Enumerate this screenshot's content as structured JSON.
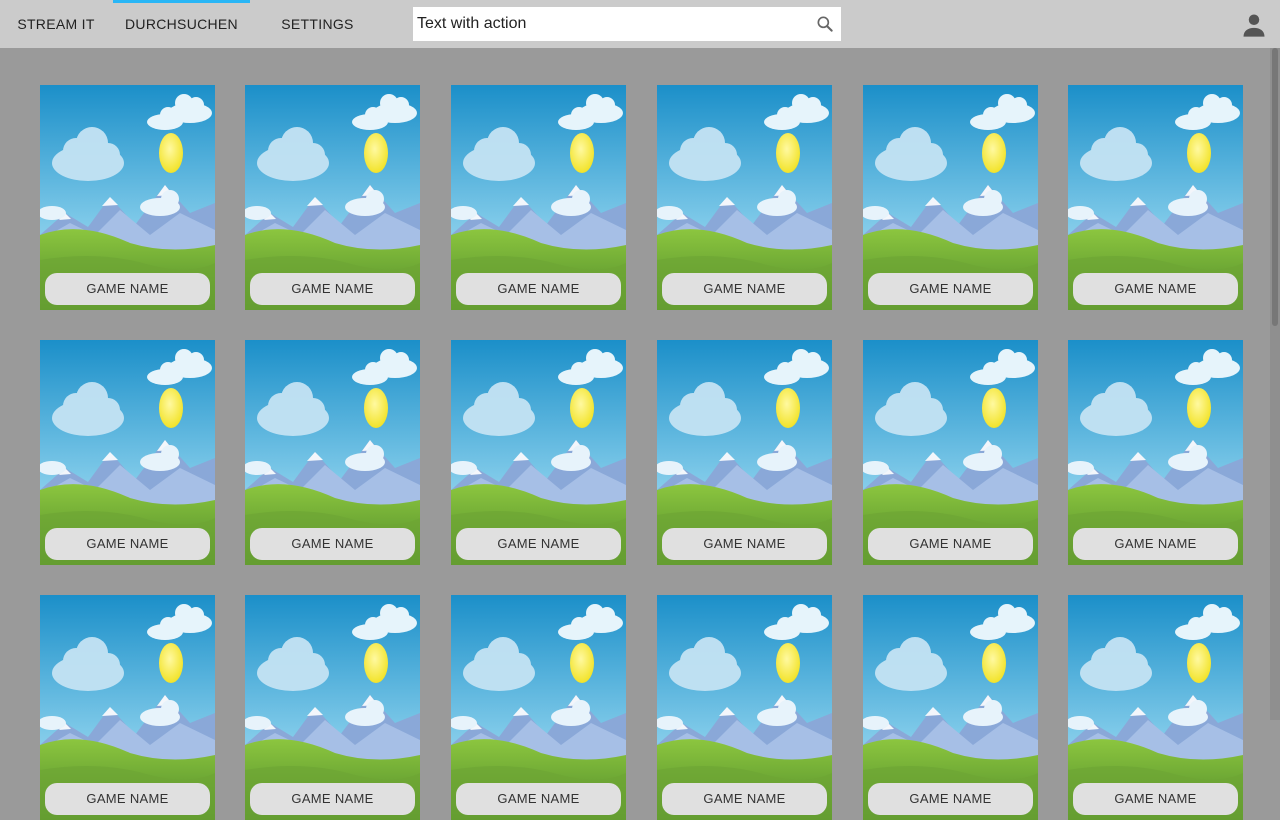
{
  "nav": {
    "tabs": [
      {
        "label": "STREAM IT",
        "active": false
      },
      {
        "label": "DURCHSUCHEN",
        "active": true
      },
      {
        "label": "SETTINGS",
        "active": false
      }
    ]
  },
  "search": {
    "value": "Text with action",
    "icon": "search-icon"
  },
  "account": {
    "icon": "account-icon"
  },
  "colors": {
    "topbar": "#cbcbcb",
    "background": "#9a9a9a",
    "active_tab_indicator": "#29b6f6",
    "card_label_bg": "#e0e0e0"
  },
  "games": [
    {
      "name": "GAME NAME"
    },
    {
      "name": "GAME NAME"
    },
    {
      "name": "GAME NAME"
    },
    {
      "name": "GAME NAME"
    },
    {
      "name": "GAME NAME"
    },
    {
      "name": "GAME NAME"
    },
    {
      "name": "GAME NAME"
    },
    {
      "name": "GAME NAME"
    },
    {
      "name": "GAME NAME"
    },
    {
      "name": "GAME NAME"
    },
    {
      "name": "GAME NAME"
    },
    {
      "name": "GAME NAME"
    },
    {
      "name": "GAME NAME"
    },
    {
      "name": "GAME NAME"
    },
    {
      "name": "GAME NAME"
    },
    {
      "name": "GAME NAME"
    },
    {
      "name": "GAME NAME"
    },
    {
      "name": "GAME NAME"
    }
  ]
}
